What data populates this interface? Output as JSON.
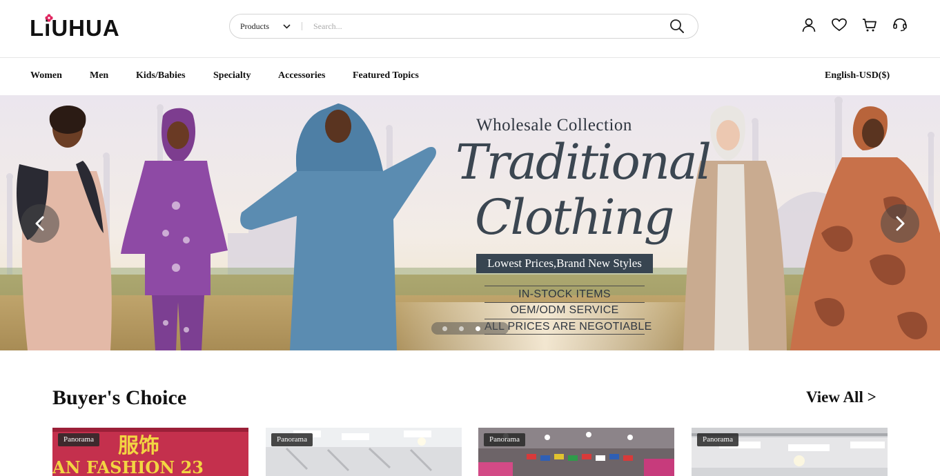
{
  "header": {
    "logo_text": "LiUHUA",
    "search": {
      "category_selected": "Products",
      "placeholder": "Search..."
    },
    "icons": [
      "account-icon",
      "wishlist-icon",
      "cart-icon",
      "support-icon"
    ]
  },
  "nav": {
    "items": [
      {
        "label": "Women"
      },
      {
        "label": "Men"
      },
      {
        "label": "Kids/Babies"
      },
      {
        "label": "Specialty"
      },
      {
        "label": "Accessories"
      },
      {
        "label": "Featured Topics"
      }
    ],
    "language_currency": "English-USD($)"
  },
  "banner": {
    "overline": "Wholesale Collection",
    "title_line1": "Traditional",
    "title_line2": "Clothing",
    "tagline": "Lowest Prices,Brand New Styles",
    "features": [
      "IN-STOCK ITEMS",
      "OEM/ODM SERVICE",
      "ALL PRICES ARE NEGOTIABLE"
    ],
    "slide_count": 3,
    "active_slide": 3,
    "colors": {
      "sky": "#e9e4ec",
      "ground": "#b99a63",
      "title": "#3b4651",
      "tagline_bg": "#384551"
    }
  },
  "buyers_choice": {
    "title": "Buyer's Choice",
    "view_all": "View All >",
    "cards": [
      {
        "badge": "Panorama",
        "sign_text": "服饰",
        "sign_text2": "AN FASHION 23"
      },
      {
        "badge": "Panorama"
      },
      {
        "badge": "Panorama"
      },
      {
        "badge": "Panorama"
      }
    ]
  }
}
